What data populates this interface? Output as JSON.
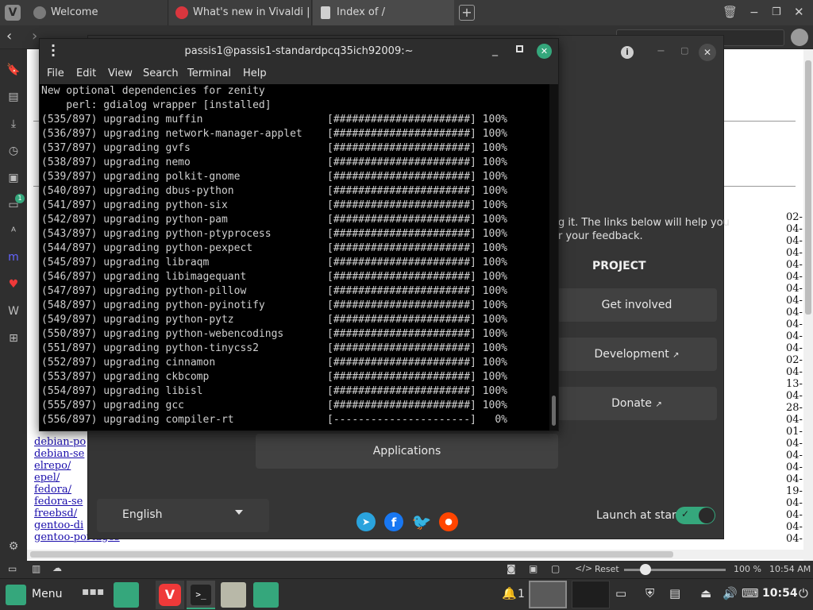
{
  "tabs": [
    {
      "label": "Welcome",
      "icon": "vivaldi-icon"
    },
    {
      "label": "What's new in Vivaldi | Viva",
      "icon": "vivaldi-icon"
    },
    {
      "label": "Index of /",
      "icon": "document-icon"
    }
  ],
  "page": {
    "links": [
      "debian-po",
      "debian-se",
      "elrepo/",
      "epel/",
      "fedora/",
      "fedora-se",
      "freebsd/",
      "gentoo-di",
      "gentoo-portages"
    ],
    "dates": [
      "02-",
      "04-",
      "04-",
      "04-",
      "04-",
      "04-",
      "04-",
      "04-",
      "04-",
      "04-",
      "04-",
      "04-",
      "02-",
      "04-",
      "13-",
      "04-",
      "28-",
      "04-",
      "01-",
      "04-",
      "04-",
      "04-",
      "04-",
      "19-",
      "04-",
      "04-",
      "04-",
      "04-"
    ]
  },
  "welcome": {
    "text_line1": "g it. The links below will help you",
    "text_line2": "r your feedback.",
    "project_heading": "PROJECT",
    "get_involved": "Get involved",
    "development": "Development",
    "donate": "Donate",
    "applications": "Applications",
    "language": "English",
    "launch_at_start": "Launch at start",
    "launch_enabled": true
  },
  "terminal": {
    "title": "passis1@passis1-standardpcq35ich92009:~",
    "menu": [
      "File",
      "Edit",
      "View",
      "Search",
      "Terminal",
      "Help"
    ],
    "lines": [
      "New optional dependencies for zenity",
      "    perl: gdialog wrapper [installed]",
      "(535/897) upgrading muffin                    [######################] 100%",
      "(536/897) upgrading network-manager-applet    [######################] 100%",
      "(537/897) upgrading gvfs                      [######################] 100%",
      "(538/897) upgrading nemo                      [######################] 100%",
      "(539/897) upgrading polkit-gnome              [######################] 100%",
      "(540/897) upgrading dbus-python               [######################] 100%",
      "(541/897) upgrading python-six                [######################] 100%",
      "(542/897) upgrading python-pam                [######################] 100%",
      "(543/897) upgrading python-ptyprocess         [######################] 100%",
      "(544/897) upgrading python-pexpect            [######################] 100%",
      "(545/897) upgrading libraqm                   [######################] 100%",
      "(546/897) upgrading libimagequant             [######################] 100%",
      "(547/897) upgrading python-pillow             [######################] 100%",
      "(548/897) upgrading python-pyinotify          [######################] 100%",
      "(549/897) upgrading python-pytz               [######################] 100%",
      "(550/897) upgrading python-webencodings       [######################] 100%",
      "(551/897) upgrading python-tinycss2           [######################] 100%",
      "(552/897) upgrading cinnamon                  [######################] 100%",
      "(553/897) upgrading ckbcomp                   [######################] 100%",
      "(554/897) upgrading libisl                    [######################] 100%",
      "(555/897) upgrading gcc                       [######################] 100%",
      "(556/897) upgrading compiler-rt               [----------------------]   0%"
    ]
  },
  "status": {
    "reset": "Reset",
    "zoom": "100 %",
    "time": "10:54 AM"
  },
  "taskbar": {
    "menu": "Menu",
    "notifications_count": "1",
    "clock": "10:54"
  },
  "colors": {
    "accent": "#35a77c",
    "vivaldi_red": "#ef3939",
    "link": "#1a0dab"
  }
}
